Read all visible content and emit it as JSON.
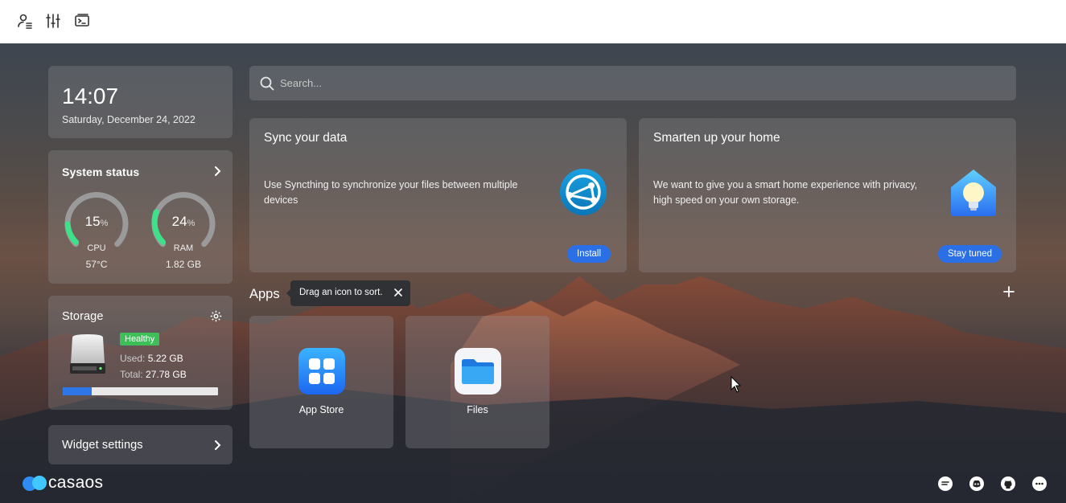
{
  "toolbar": {
    "icons": [
      "user-list-icon",
      "sliders-icon",
      "terminal-icon"
    ]
  },
  "clock": {
    "time": "14:07",
    "date": "Saturday, December 24, 2022"
  },
  "system_status": {
    "title": "System status",
    "cpu": {
      "value": "15",
      "unit": "%",
      "label": "CPU",
      "sub": "57°C",
      "percent": 15
    },
    "ram": {
      "value": "24",
      "unit": "%",
      "label": "RAM",
      "sub": "1.82 GB",
      "percent": 24
    },
    "accent": "#3fe08a"
  },
  "storage": {
    "title": "Storage",
    "badge": "Healthy",
    "used_label": "Used:",
    "used_value": "5.22 GB",
    "total_label": "Total:",
    "total_value": "27.78 GB",
    "used_fraction": 0.188
  },
  "widget_settings": {
    "label": "Widget settings"
  },
  "search": {
    "placeholder": "Search..."
  },
  "cards": [
    {
      "title": "Sync your data",
      "desc": "Use Syncthing to synchronize your files between multiple devices",
      "button": "Install"
    },
    {
      "title": "Smarten up your home",
      "desc": "We want to give you a smart home experience with privacy, high speed on your own storage.",
      "button": "Stay tuned"
    }
  ],
  "apps": {
    "title": "Apps",
    "tooltip": "Drag an icon to sort.",
    "items": [
      {
        "name": "App Store",
        "icon": "app-store-icon"
      },
      {
        "name": "Files",
        "icon": "files-icon"
      }
    ]
  },
  "footer": {
    "brand": "casaos",
    "icons": [
      "chat-icon",
      "discord-icon",
      "github-icon",
      "feedback-icon"
    ]
  },
  "colors": {
    "primary": "#2b6fe6",
    "healthy": "#3fbf5a"
  }
}
